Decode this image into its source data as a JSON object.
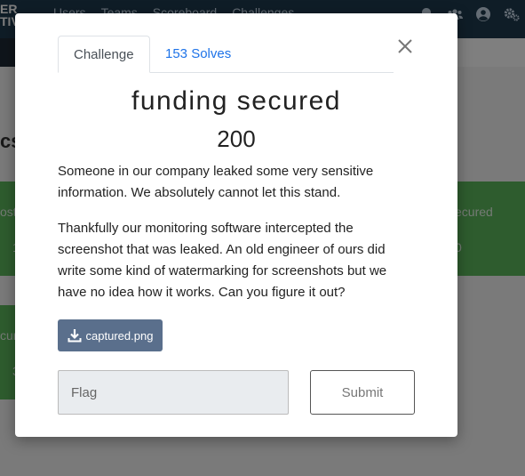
{
  "navbar": {
    "logo_line1": "ER",
    "logo_line2": "TIV",
    "links": [
      "Users",
      "Teams",
      "Scoreboard",
      "Challenges"
    ],
    "icons": [
      "bell-icon",
      "users-icon",
      "user-circle-icon",
      "cogs-icon"
    ],
    "color": "#1e3a4f"
  },
  "background": {
    "category_partial": "cs",
    "card1_left_text": "ost",
    "card1_left_value": "1",
    "card1_right_text": "ecured",
    "card1_right_value": "0",
    "card2_text": "cur",
    "card2_value": "3",
    "card_color": "#5cb85c"
  },
  "modal": {
    "tabs": {
      "challenge": "Challenge",
      "solves": "153 Solves"
    },
    "title": "funding secured",
    "value": "200",
    "description": [
      "Someone in our company leaked some very sensitive information. We absolutely cannot let this stand.",
      "Thankfully our monitoring software intercepted the screenshot that was leaked. An old engineer of ours did write some kind of watermarking for screenshots but we have no idea how it works. Can you figure it out?"
    ],
    "file_label": "captured.png",
    "flag_placeholder": "Flag",
    "submit_label": "Submit",
    "accent_color": "#1e73e8",
    "file_button_color": "#5a6f8c"
  }
}
